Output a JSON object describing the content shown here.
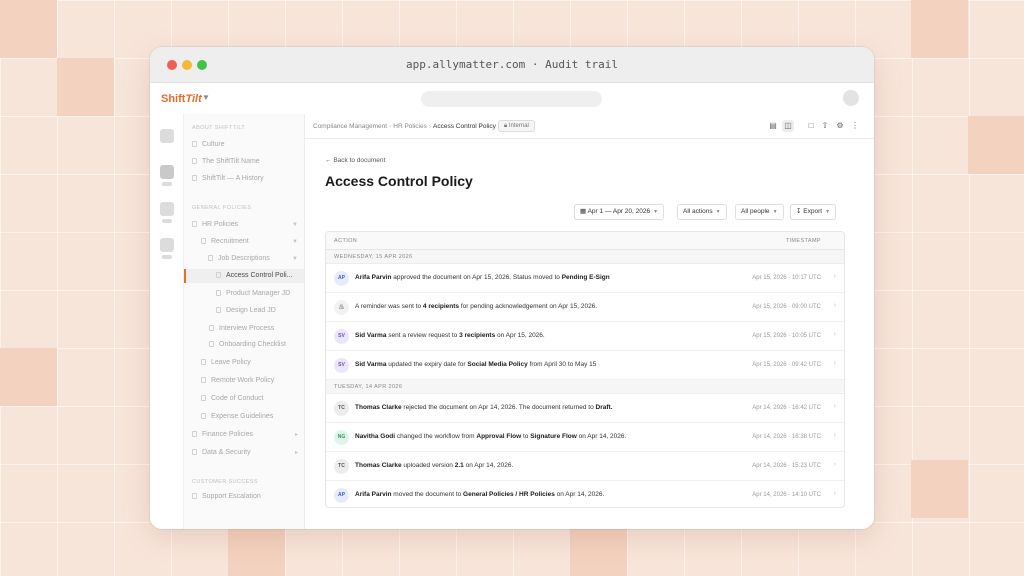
{
  "window": {
    "url_title": "app.allymatter.com · Audit trail"
  },
  "app": {
    "logo_main": "Shift",
    "logo_accent": "Tilt"
  },
  "sidebar": {
    "section_about": "ABOUT SHIFTTILT",
    "about_items": [
      "Culture",
      "The ShiftTilt Name",
      "ShiftTilt — A History"
    ],
    "section_general": "GENERAL POLICIES",
    "hr_policies": "HR Policies",
    "recruitment": "Recruitment",
    "job_descriptions": "Job Descriptions",
    "access_control": "Access Control Poli...",
    "product_manager": "Product Manager JD",
    "design_lead": "Design Lead JD",
    "interview_process": "Interview Process",
    "onboarding": "Onboarding Checklist",
    "leave_policy": "Leave Policy",
    "remote_work": "Remote Work Policy",
    "code_of_conduct": "Code of Conduct",
    "expense_guidelines": "Expense Guidelines",
    "finance_policies": "Finance Policies",
    "data_security": "Data & Security",
    "section_customer": "CUSTOMER SUCCESS",
    "support_escalation": "Support Escalation"
  },
  "breadcrumb": {
    "items": [
      "Compliance Management",
      "HR Policies",
      "Access Control Policy"
    ],
    "badge": "Internal"
  },
  "page": {
    "back_label": "Back to document",
    "title": "Access Control Policy"
  },
  "filters": {
    "date_range": "Apr 1 — Apr 20, 2026",
    "actions": "All actions",
    "people": "All people",
    "export": "Export"
  },
  "table": {
    "col_action": "ACTION",
    "col_timestamp": "TIMESTAMP",
    "group1": "WEDNESDAY, 15 APR 2026",
    "group2": "TUESDAY, 14 APR 2026",
    "rows": [
      {
        "initials": "AP",
        "p1": "Arifa Parvin",
        "p2": " approved the document on Apr 15, 2026. Status moved to ",
        "p3": "Pending E-Sign",
        "p4": "",
        "p5": "",
        "p6": "",
        "ts": "Apr 15, 2026 · 10:17 UTC"
      },
      {
        "initials": "",
        "p1": "",
        "p2": "A reminder was sent to ",
        "p3": "4 recipients",
        "p4": " for pending acknowledgement on Apr 15, 2026.",
        "p5": "",
        "p6": "",
        "ts": "Apr 15, 2026 · 09:00 UTC"
      },
      {
        "initials": "SV",
        "p1": "Sid Varma",
        "p2": " sent a review request to ",
        "p3": "3 recipients",
        "p4": " on Apr 15, 2026.",
        "p5": "",
        "p6": "",
        "ts": "Apr 15, 2026 · 10:05 UTC"
      },
      {
        "initials": "SV",
        "p1": "Sid Varma",
        "p2": " updated the expiry date for ",
        "p3": "Social Media Policy",
        "p4": " from April 30 to May 15",
        "p5": "",
        "p6": "",
        "ts": "Apr 15, 2026 · 09:42 UTC"
      },
      {
        "initials": "TC",
        "p1": "Thomas Clarke",
        "p2": " rejected the document on Apr 14, 2026. The document returned to ",
        "p3": "Draft.",
        "p4": "",
        "p5": "",
        "p6": "",
        "ts": "Apr 14, 2026 · 16:42 UTC"
      },
      {
        "initials": "NG",
        "p1": "Navitha Godi",
        "p2": " changed the workflow from ",
        "p3": "Approval Flow",
        "p4": " to ",
        "p5": "Signature Flow",
        "p6": " on Apr 14, 2026.",
        "ts": "Apr 14, 2026 · 16:38 UTC"
      },
      {
        "initials": "TC",
        "p1": "Thomas Clarke",
        "p2": " uploaded version ",
        "p3": "2.1",
        "p4": " on Apr 14, 2026.",
        "p5": "",
        "p6": "",
        "ts": "Apr 14, 2026 · 15:23 UTC"
      },
      {
        "initials": "AP",
        "p1": "Arifa Parvin",
        "p2": " moved the document to ",
        "p3": "General Policies / HR Policies",
        "p4": " on Apr 14, 2026.",
        "p5": "",
        "p6": "",
        "ts": "Apr 14, 2026 · 14:10 UTC"
      }
    ]
  },
  "colors": {
    "accent": "#ea6a2a",
    "background": "#f8e5da",
    "avatar_ap_bg": "#e6ecfb",
    "avatar_sv_bg": "#ece6fb",
    "avatar_tc_bg": "#ececec",
    "avatar_ng_bg": "#dff5ea"
  },
  "icons": {
    "reminder": "bell-icon",
    "toolbar": [
      "chart-icon",
      "clipboard-icon",
      "comment-icon",
      "share-icon",
      "gear-icon",
      "more-vertical-icon"
    ]
  }
}
